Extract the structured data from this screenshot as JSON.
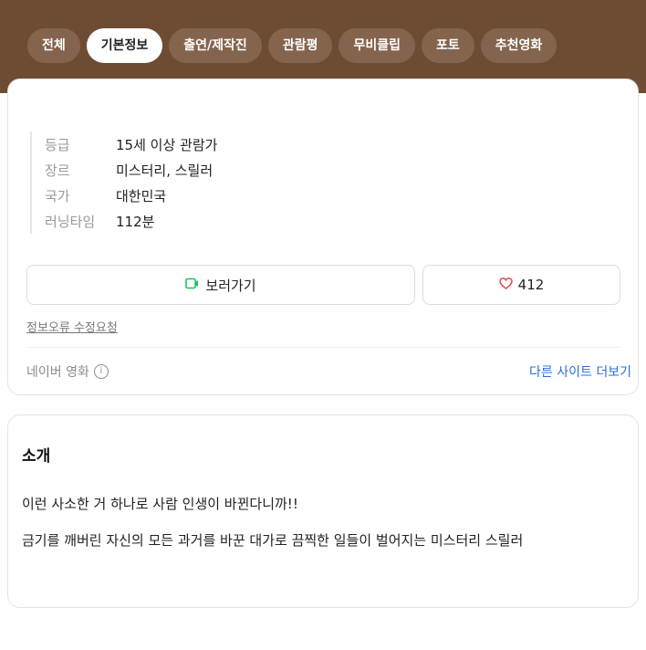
{
  "tabs": [
    {
      "label": "전체"
    },
    {
      "label": "기본정보",
      "active": true
    },
    {
      "label": "출연/제작진"
    },
    {
      "label": "관람평"
    },
    {
      "label": "무비클립"
    },
    {
      "label": "포토"
    },
    {
      "label": "추천영화"
    }
  ],
  "info": {
    "rows": [
      {
        "label": "등급",
        "value": "15세 이상 관람가"
      },
      {
        "label": "장르",
        "value": "미스터리, 스릴러"
      },
      {
        "label": "국가",
        "value": "대한민국"
      },
      {
        "label": "러닝타임",
        "value": "112분"
      }
    ]
  },
  "actions": {
    "watch_label": "보러가기",
    "like_count": "412"
  },
  "report_label": "정보오류 수정요청",
  "source": {
    "name": "네이버 영화",
    "more_label": "다른 사이트 더보기"
  },
  "intro": {
    "title": "소개",
    "lines": [
      "이런 사소한 거 하나로 사람 인생이 바뀐다니까!!",
      "금기를 깨버린 자신의 모든 과거를 바꾼 대가로 끔찍한 일들이 벌어지는 미스터리 스릴러"
    ]
  },
  "colors": {
    "header_brown": "#6e4c34",
    "tab_inactive": "#85644d",
    "link_blue": "#2a6fd6",
    "play_green": "#21c35e",
    "heart_red": "#e14a55"
  },
  "icons": {
    "play": "play-icon",
    "heart": "heart-icon",
    "info": "info-icon"
  }
}
